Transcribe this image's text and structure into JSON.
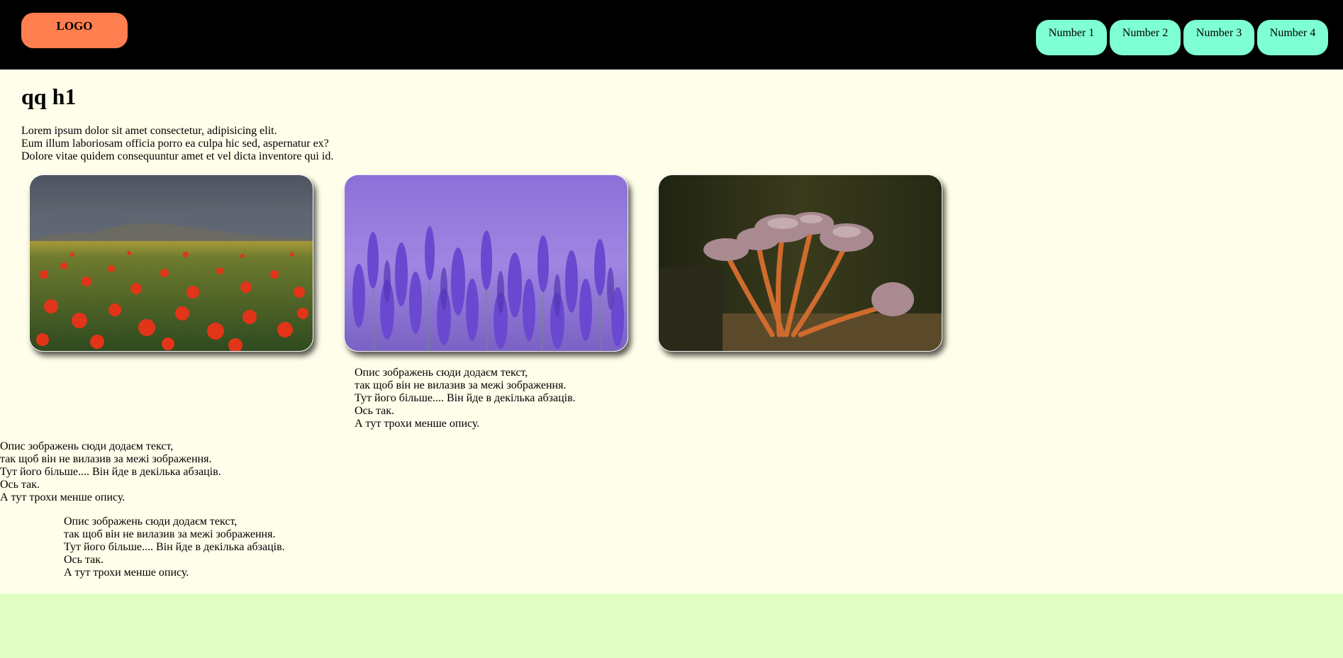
{
  "header": {
    "logo": "LOGO",
    "nav": [
      "Number 1",
      "Number 2",
      "Number 3",
      "Number 4"
    ]
  },
  "main": {
    "title": "qq h1",
    "intro": [
      "Lorem ipsum dolor sit amet consectetur, adipisicing elit.",
      "Eum illum laboriosam officia porro ea culpa hic sed, aspernatur ex?",
      "Dolore vitae quidem consequuntur amet et vel dicta inventore qui id."
    ],
    "images": [
      {
        "icon": "poppy-field-image"
      },
      {
        "icon": "lavander-image"
      },
      {
        "icon": "mushrooms-image"
      }
    ],
    "descriptions": [
      {
        "lines": [
          "Опис зображень сюди додаєм текст,",
          "так щоб він не вилазив за межі зображення.",
          "Тут його більше.... Він йде в декілька абзаців.",
          "Ось так.",
          "А тут трохи менше опису."
        ]
      },
      {
        "lines": [
          "Опис зображень сюди додаєм текст,",
          "так щоб він не вилазив за межі зображення.",
          "Тут його більше.... Він йде в декілька абзаців.",
          "Ось так.",
          "А тут трохи менше опису."
        ]
      },
      {
        "lines": [
          "Опис зображень сюди додаєм текст,",
          "так щоб він не вилазив за межі зображення.",
          "Тут його більше.... Він йде в декілька абзаців.",
          "Ось так.",
          "А тут трохи менше опису."
        ]
      }
    ]
  },
  "colors": {
    "header_bg": "#000000",
    "logo_bg": "#ff7f50",
    "nav_bg": "#7fffd4",
    "main_bg": "#fffeea",
    "page_bg": "#e0fec4"
  }
}
